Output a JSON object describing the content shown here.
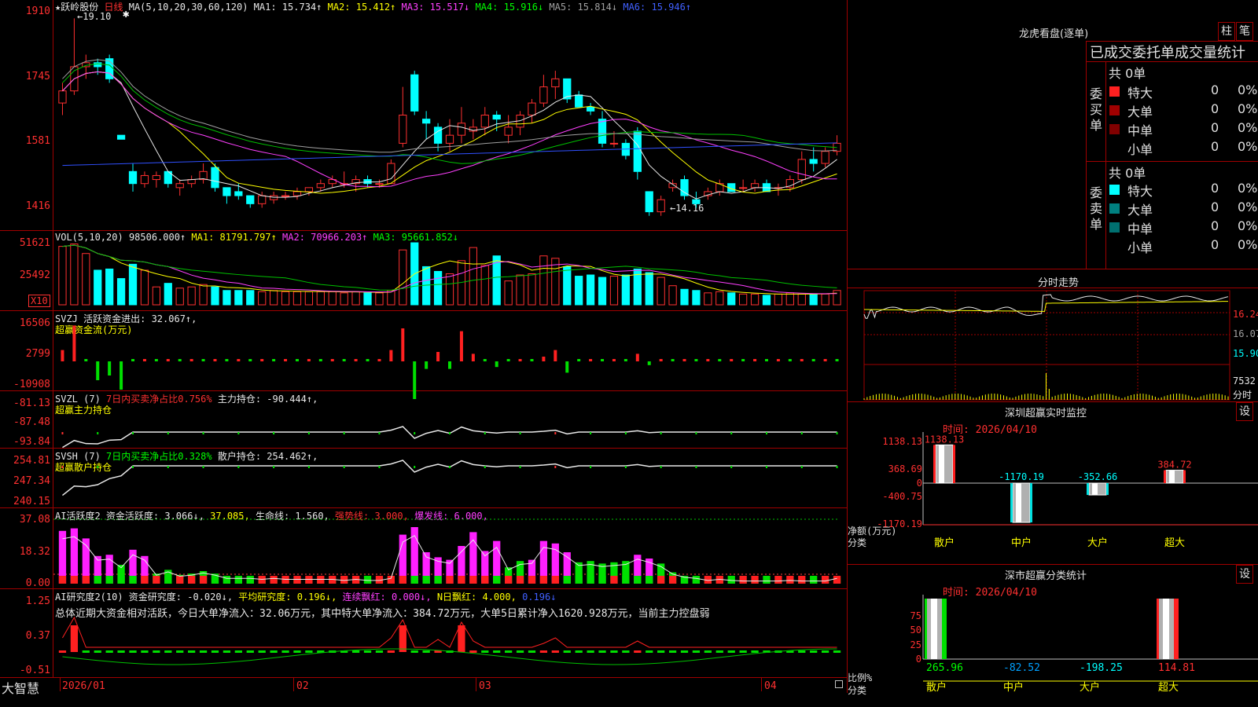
{
  "stock": {
    "name": "★跃岭股份",
    "period": "日线"
  },
  "ma_header": {
    "label": "MA(5,10,20,30,60,120)",
    "ma1": "MA1: 15.734↑",
    "ma2": "MA2: 15.412↑",
    "ma3": "MA3: 15.517↓",
    "ma4": "MA4: 15.916↓",
    "ma5": "MA5: 15.814↓",
    "ma6": "MA6: 15.946↑"
  },
  "price_axis": [
    "1910",
    "1745",
    "1581",
    "1416"
  ],
  "price_annotations": {
    "high": "←19.10",
    "low": "←14.16"
  },
  "vol_header": {
    "label": "VOL(5,10,20)",
    "vol": "98506.000↑",
    "ma1": "MA1: 81791.797↑",
    "ma2": "MA2: 70966.203↑",
    "ma3": "MA3: 95661.852↓"
  },
  "vol_axis": [
    "51621",
    "25492"
  ],
  "vol_unit": "X10",
  "svzj": {
    "line1": "SVZJ  活跃资金进出: 32.067↑,",
    "line2": "超赢资金流(万元)",
    "axis": [
      "16506",
      "2799",
      "-10908"
    ]
  },
  "svzl": {
    "prefix": "SVZL (7)",
    "pct": "7日内买卖净占比0.756%",
    "hold": "主力持仓: -90.444↑,",
    "line2": "超赢主力持仓",
    "axis": [
      "-81.13",
      "-87.48",
      "-93.84"
    ]
  },
  "svsh": {
    "prefix": "SVSH (7)",
    "pct": "7日内买卖净占比0.328%",
    "hold": "散户持仓: 254.462↑,",
    "line2": "超赢散户持仓",
    "axis": [
      "254.81",
      "247.34",
      "240.15"
    ]
  },
  "ai_active": {
    "label": "AI活跃度2 资金活跃度: 3.066↓,",
    "v2": "37.085,",
    "life": "生命线: 1.560,",
    "strong": "强势线: 3.000,",
    "burst": "爆发线: 6.000,",
    "axis": [
      "37.08",
      "18.32",
      "0.00"
    ]
  },
  "ai_research": {
    "label": "AI研究度2(10) 资金研究度: -0.020↓,",
    "avg": "平均研究度: 0.196↓,",
    "lian": "连续飘红: 0.000↓,",
    "nday": "N日飘红: 4.000,",
    "v5": "0.196↓",
    "summary": "总体近期大资金相对活跃，今日大单净流入：32.06万元，其中特大单净流入：384.72万元，大单5日累计净入1620.928万元，当前主力控盘弱",
    "axis": [
      "1.25",
      "0.37",
      "-0.51"
    ]
  },
  "bottom_bar": {
    "brand": "大智慧",
    "dates": [
      "2026/01",
      "02",
      "03",
      "04"
    ]
  },
  "dragon": {
    "title": "龙虎看盘(逐单)",
    "btn1": "柱",
    "btn2": "笔",
    "subtitle": "已成交委托单成交量统计",
    "buy_label": "委买单",
    "sell_label": "委卖单",
    "buy_total": "共 0单",
    "sell_total": "共 0单",
    "buy_rows": [
      {
        "name": "特大",
        "n": "0",
        "pct": "0%"
      },
      {
        "name": "大单",
        "n": "0",
        "pct": "0%"
      },
      {
        "name": "中单",
        "n": "0",
        "pct": "0%"
      },
      {
        "name": "小单",
        "n": "0",
        "pct": "0%"
      }
    ],
    "sell_rows": [
      {
        "name": "特大",
        "n": "0",
        "pct": "0%"
      },
      {
        "name": "大单",
        "n": "0",
        "pct": "0%"
      },
      {
        "name": "中单",
        "n": "0",
        "pct": "0%"
      },
      {
        "name": "小单",
        "n": "0",
        "pct": "0%"
      }
    ]
  },
  "intraday": {
    "title": "分时走势",
    "p1": "16.24",
    "p2": "16.07",
    "p3": "15.90",
    "vol": "7532",
    "unit": "分时"
  },
  "sz_monitor": {
    "title": "深圳超赢实时监控",
    "btn": "设",
    "time": "时间: 2026/04/10",
    "axis": [
      "1138.13",
      "368.69",
      "0",
      "-400.75",
      "-1170.19"
    ],
    "ylabel": "净额(万元)",
    "xlabel": "分类",
    "values": [
      "1138.13",
      "-1170.19",
      "-352.66",
      "384.72"
    ],
    "cats": [
      "散户",
      "中户",
      "大户",
      "超大"
    ]
  },
  "sz_class": {
    "title": "深市超赢分类统计",
    "btn": "设",
    "time": "时间: 2026/04/10",
    "axis": [
      "75",
      "50",
      "25",
      "0"
    ],
    "ylabel": "比例%",
    "xlabel": "分类",
    "values": [
      "265.96",
      "-82.52",
      "-198.25",
      "114.81"
    ],
    "cats": [
      "散户",
      "中户",
      "大户",
      "超大"
    ]
  },
  "chart_data": {
    "type": "candlestick",
    "candles": [
      [
        17.0,
        17.5,
        16.7,
        17.3
      ],
      [
        17.3,
        19.1,
        17.2,
        17.9
      ],
      [
        17.9,
        18.2,
        17.6,
        18.0
      ],
      [
        18.0,
        18.1,
        17.7,
        17.9
      ],
      [
        18.1,
        18.2,
        17.5,
        17.6
      ],
      [
        16.2,
        16.2,
        16.1,
        16.1
      ],
      [
        15.3,
        15.5,
        14.8,
        15.0
      ],
      [
        15.0,
        15.3,
        14.9,
        15.2
      ],
      [
        15.1,
        15.3,
        14.9,
        15.2
      ],
      [
        15.3,
        15.3,
        14.9,
        15.0
      ],
      [
        14.9,
        15.1,
        14.7,
        15.0
      ],
      [
        15.0,
        15.2,
        14.9,
        15.1
      ],
      [
        15.1,
        15.5,
        15.0,
        15.3
      ],
      [
        15.4,
        15.5,
        14.8,
        14.9
      ],
      [
        14.9,
        14.9,
        14.5,
        14.7
      ],
      [
        14.8,
        15.0,
        14.6,
        14.7
      ],
      [
        14.7,
        14.7,
        14.4,
        14.5
      ],
      [
        14.5,
        14.8,
        14.4,
        14.7
      ],
      [
        14.6,
        14.8,
        14.5,
        14.7
      ],
      [
        14.7,
        14.8,
        14.6,
        14.7
      ],
      [
        14.7,
        14.9,
        14.6,
        14.8
      ],
      [
        14.8,
        14.9,
        14.7,
        14.9
      ],
      [
        14.9,
        15.1,
        14.8,
        15.0
      ],
      [
        15.0,
        15.2,
        14.9,
        15.1
      ],
      [
        15.0,
        15.3,
        14.9,
        15.0
      ],
      [
        15.0,
        15.2,
        14.8,
        15.1
      ],
      [
        15.1,
        15.2,
        14.9,
        15.0
      ],
      [
        15.0,
        15.1,
        14.9,
        15.0
      ],
      [
        15.0,
        15.6,
        15.0,
        15.5
      ],
      [
        16.0,
        17.4,
        15.9,
        16.7
      ],
      [
        17.7,
        17.8,
        16.7,
        16.8
      ],
      [
        16.6,
        16.8,
        16.1,
        16.5
      ],
      [
        16.4,
        16.5,
        15.8,
        16.0
      ],
      [
        16.0,
        16.6,
        15.8,
        16.2
      ],
      [
        16.2,
        16.9,
        16.0,
        16.5
      ],
      [
        16.3,
        16.6,
        16.1,
        16.4
      ],
      [
        16.4,
        16.9,
        16.2,
        16.7
      ],
      [
        16.7,
        16.8,
        16.3,
        16.6
      ],
      [
        16.2,
        16.7,
        16.0,
        16.4
      ],
      [
        16.4,
        16.8,
        16.2,
        16.7
      ],
      [
        16.7,
        17.1,
        16.5,
        17.0
      ],
      [
        17.0,
        17.7,
        16.9,
        17.4
      ],
      [
        17.4,
        17.8,
        17.1,
        17.6
      ],
      [
        17.6,
        17.6,
        17.0,
        17.1
      ],
      [
        17.2,
        17.3,
        16.9,
        16.9
      ],
      [
        16.9,
        17.0,
        16.7,
        16.8
      ],
      [
        16.6,
        16.8,
        15.9,
        16.0
      ],
      [
        16.0,
        16.3,
        15.9,
        16.0
      ],
      [
        16.0,
        16.1,
        15.6,
        15.7
      ],
      [
        16.3,
        16.4,
        15.1,
        15.3
      ],
      [
        14.8,
        14.8,
        14.2,
        14.3
      ],
      [
        14.3,
        14.7,
        14.2,
        14.6
      ],
      [
        14.9,
        15.1,
        14.8,
        15.0
      ],
      [
        15.1,
        15.2,
        14.6,
        14.7
      ],
      [
        14.6,
        14.8,
        14.4,
        14.5
      ],
      [
        14.7,
        14.9,
        14.6,
        14.8
      ],
      [
        14.8,
        15.1,
        14.7,
        15.0
      ],
      [
        15.0,
        15.0,
        14.8,
        14.8
      ],
      [
        14.9,
        15.1,
        14.8,
        14.9
      ],
      [
        14.9,
        15.1,
        14.8,
        15.0
      ],
      [
        15.0,
        15.1,
        14.8,
        14.8
      ],
      [
        14.9,
        15.0,
        14.7,
        14.9
      ],
      [
        14.9,
        15.2,
        14.8,
        15.1
      ],
      [
        15.1,
        15.8,
        15.0,
        15.6
      ],
      [
        15.6,
        15.9,
        15.3,
        15.5
      ],
      [
        15.5,
        15.9,
        15.4,
        15.8
      ],
      [
        15.8,
        16.2,
        15.7,
        16.0
      ]
    ],
    "price_ylim": [
      14.16,
      19.1
    ],
    "volumes": [
      4.9,
      5.1,
      4.3,
      2.9,
      3.0,
      2.2,
      3.4,
      2.9,
      1.5,
      1.8,
      1.4,
      1.5,
      1.7,
      1.5,
      1.2,
      1.2,
      1.2,
      1.1,
      1.2,
      1.1,
      1.1,
      1.1,
      1.1,
      1.1,
      1.0,
      1.1,
      1.0,
      1.0,
      1.2,
      4.6,
      5.2,
      3.2,
      2.8,
      2.6,
      3.7,
      4.8,
      3.3,
      4.1,
      2.0,
      2.5,
      2.6,
      4.1,
      3.9,
      3.2,
      2.4,
      2.5,
      2.3,
      2.4,
      2.5,
      3.0,
      2.7,
      2.3,
      1.6,
      1.3,
      1.2,
      1.0,
      1.1,
      1.0,
      0.9,
      0.9,
      0.8,
      0.9,
      1.0,
      0.9,
      0.9,
      0.9,
      1.2
    ],
    "money_flow": [
      1200,
      3800,
      0,
      -2000,
      -1500,
      -3000,
      0,
      0,
      0,
      0,
      0,
      0,
      0,
      0,
      0,
      0,
      0,
      0,
      0,
      0,
      0,
      0,
      0,
      0,
      0,
      0,
      0,
      0,
      1200,
      3500,
      -4000,
      -800,
      1000,
      -800,
      3200,
      800,
      0,
      -600,
      0,
      0,
      0,
      500,
      1200,
      -1200,
      0,
      0,
      0,
      0,
      0,
      800,
      -400,
      0,
      0,
      0,
      0,
      0,
      0,
      0,
      0,
      0,
      0,
      0,
      0,
      0,
      0,
      0,
      0
    ]
  }
}
